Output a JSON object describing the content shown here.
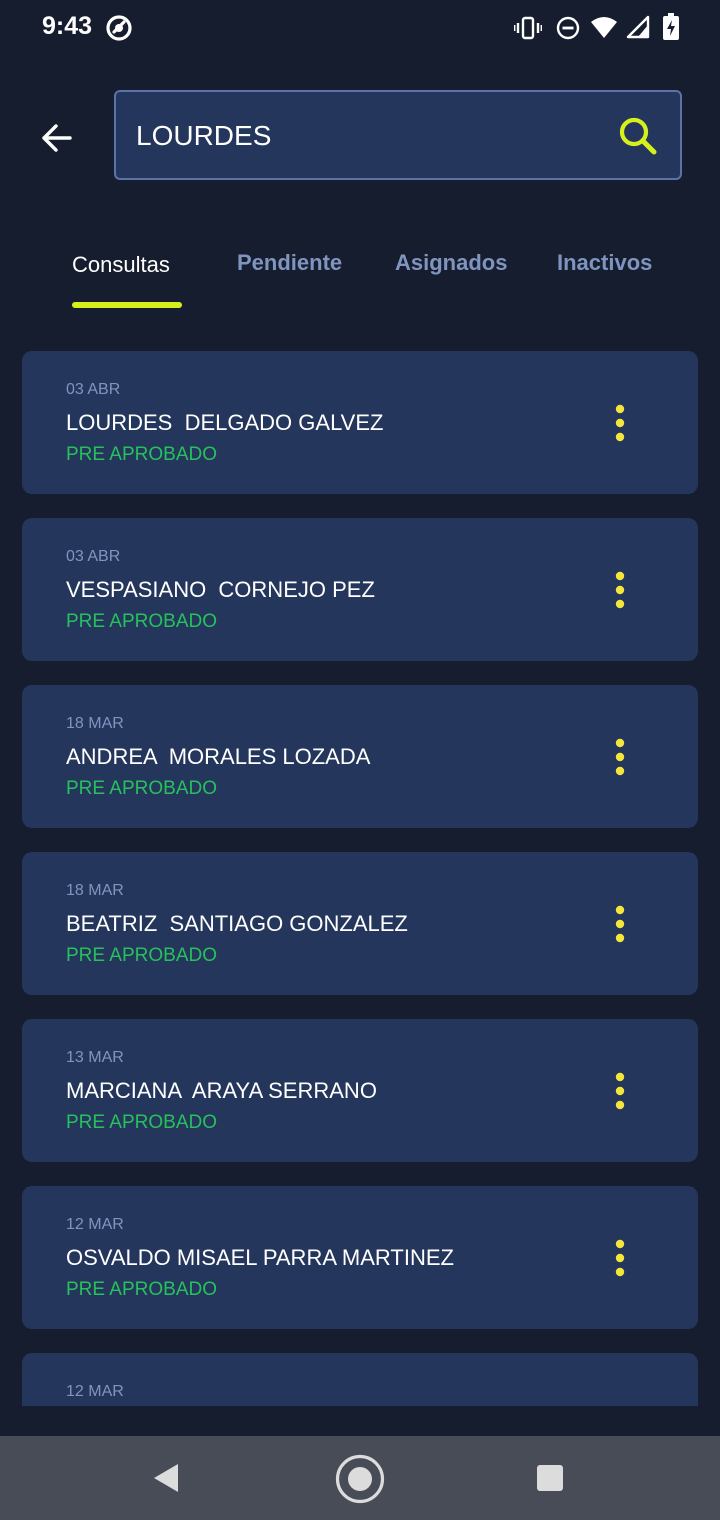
{
  "status_bar": {
    "time": "9:43",
    "icons": [
      "at-sign-icon",
      "vibrate-icon",
      "do-not-disturb-icon",
      "wifi-icon",
      "signal-icon",
      "battery-icon"
    ]
  },
  "header": {
    "back_icon": "arrow-left-icon",
    "search": {
      "value": "LOURDES",
      "icon": "search-icon",
      "icon_color": "#d6f01d"
    }
  },
  "tabs": [
    {
      "label": "Consultas",
      "active": true
    },
    {
      "label": "Pendiente",
      "active": false
    },
    {
      "label": "Asignados",
      "active": false
    },
    {
      "label": "Inactivos",
      "active": false
    }
  ],
  "items": [
    {
      "date": "03 ABR",
      "name": "LOURDES  DELGADO GALVEZ",
      "status": "PRE APROBADO"
    },
    {
      "date": "03 ABR",
      "name": "VESPASIANO  CORNEJO PEZ",
      "status": "PRE APROBADO"
    },
    {
      "date": "18 MAR",
      "name": "ANDREA  MORALES LOZADA",
      "status": "PRE APROBADO"
    },
    {
      "date": "18 MAR",
      "name": "BEATRIZ  SANTIAGO GONZALEZ",
      "status": "PRE APROBADO"
    },
    {
      "date": "13 MAR",
      "name": "MARCIANA  ARAYA SERRANO",
      "status": "PRE APROBADO"
    },
    {
      "date": "12 MAR",
      "name": "OSVALDO MISAEL PARRA MARTINEZ",
      "status": "PRE APROBADO"
    },
    {
      "date": "12 MAR",
      "name": "",
      "status": ""
    }
  ],
  "colors": {
    "background": "#161d2e",
    "card": "#25365c",
    "accent": "#d6f01d",
    "status_green": "#26c15c",
    "muted_text": "#7f95bf"
  },
  "nav_bar": {
    "icons": [
      "back-triangle-icon",
      "home-circle-icon",
      "recents-square-icon"
    ]
  }
}
